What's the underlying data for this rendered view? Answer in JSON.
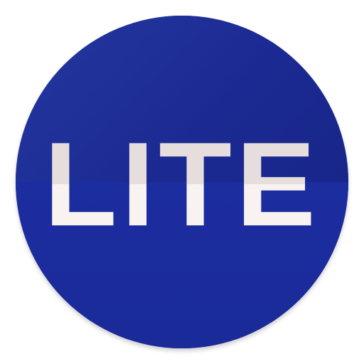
{
  "app_icon": {
    "label": "LITE",
    "colors": {
      "badge_blue": "#1a2b99",
      "text": "#f6f0ee"
    }
  }
}
